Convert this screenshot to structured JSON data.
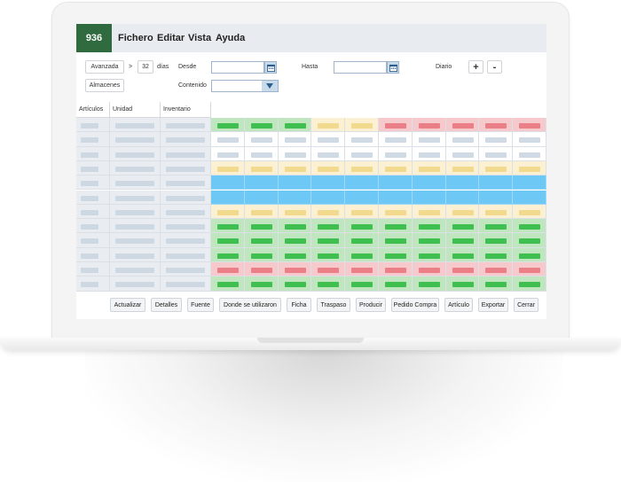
{
  "menubar": {
    "badge": "936",
    "items": [
      "Fichero",
      "Editar",
      "Vista",
      "Ayuda"
    ]
  },
  "toolbar": {
    "mode_button": "Avanzada",
    "arrow": ">",
    "days_value": "32",
    "days_label": "días",
    "from_label": "Desde",
    "to_label": "Hasta",
    "period_label": "Diario",
    "plus_label": "+",
    "minus_label": "-",
    "warehouses_button": "Almacenes",
    "content_label": "Contenido"
  },
  "grid": {
    "columns": [
      "Artículos",
      "Unidad",
      "Inventario"
    ],
    "rows": [
      [
        "green",
        "green",
        "green",
        "yellow",
        "yellow",
        "red",
        "red",
        "red",
        "red",
        "red"
      ],
      [
        "white",
        "white",
        "white",
        "white",
        "white",
        "white",
        "white",
        "white",
        "white",
        "white"
      ],
      [
        "white",
        "white",
        "white",
        "white",
        "white",
        "white",
        "white",
        "white",
        "white",
        "white"
      ],
      [
        "yellow",
        "yellow",
        "yellow",
        "yellow",
        "yellow",
        "yellow",
        "yellow",
        "yellow",
        "yellow",
        "yellow"
      ],
      [
        "blue",
        "blue",
        "blue",
        "blue",
        "blue",
        "blue",
        "blue",
        "blue",
        "blue",
        "blue"
      ],
      [
        "blue",
        "blue",
        "blue",
        "blue",
        "blue",
        "blue",
        "blue",
        "blue",
        "blue",
        "blue"
      ],
      [
        "yellow",
        "yellow",
        "yellow",
        "yellow",
        "yellow",
        "yellow",
        "yellow",
        "yellow",
        "yellow",
        "yellow"
      ],
      [
        "green",
        "green",
        "green",
        "green",
        "green",
        "green",
        "green",
        "green",
        "green",
        "green"
      ],
      [
        "green",
        "green",
        "green",
        "green",
        "green",
        "green",
        "green",
        "green",
        "green",
        "green"
      ],
      [
        "green",
        "green",
        "green",
        "green",
        "green",
        "green",
        "green",
        "green",
        "green",
        "green"
      ],
      [
        "red",
        "red",
        "red",
        "red",
        "red",
        "red",
        "red",
        "red",
        "red",
        "red"
      ],
      [
        "green",
        "green",
        "green",
        "green",
        "green",
        "green",
        "green",
        "green",
        "green",
        "green"
      ]
    ]
  },
  "footer": {
    "buttons": [
      "Actualizar",
      "Detalles",
      "Fuente",
      "Donde se utilizaron",
      "Ficha",
      "Traspaso",
      "Producir",
      "Pedido Compra",
      "Artículo",
      "Exportar",
      "Cerrar"
    ]
  },
  "colors": {
    "badge": "#2f6b3f",
    "green_bg": "#bfe6bf",
    "green_bar": "#3fbf4f",
    "yellow_bg": "#fbf1d2",
    "yellow_bar": "#f1d98e",
    "red_bg": "#f6c9cd",
    "red_bar": "#eb7f88",
    "blue_bg": "#6ec8f5",
    "white_bar": "#cfdae5",
    "left_bg": "#e9edf1",
    "left_bar": "#cdd8e3"
  }
}
